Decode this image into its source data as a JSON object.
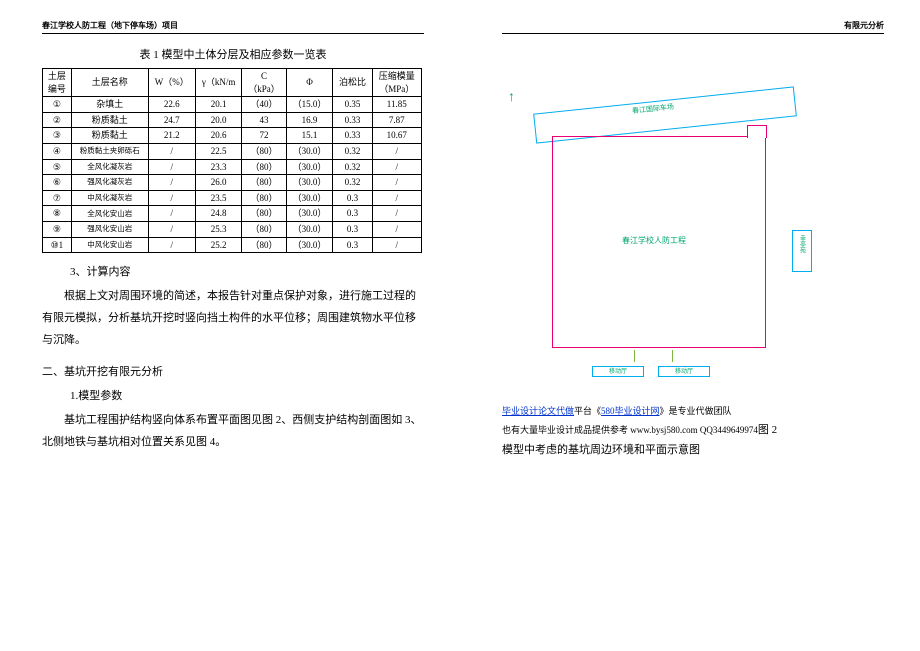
{
  "header": {
    "left": "春江学校人防工程（地下停车场）项目",
    "right": "有限元分析"
  },
  "table": {
    "title": "表 1  模型中土体分层及相应参数一览表",
    "cols": {
      "c1a": "土层",
      "c1b": "编号",
      "c2": "土层名称",
      "c3": "W（%）",
      "c4": "γ（kN/m",
      "c5a": "C",
      "c5b": "（kPa）",
      "c6": "Φ",
      "c7": "泊松比",
      "c8a": "压缩模量",
      "c8b": "（MPa）"
    },
    "rows": [
      {
        "id": "①",
        "name": "杂填土",
        "w": "22.6",
        "g": "20.1",
        "c": "（40）",
        "phi": "（15.0）",
        "po": "0.35",
        "e": "11.85"
      },
      {
        "id": "②",
        "name": "粉质黏土",
        "w": "24.7",
        "g": "20.0",
        "c": "43",
        "phi": "16.9",
        "po": "0.33",
        "e": "7.87"
      },
      {
        "id": "③",
        "name": "粉质黏土",
        "w": "21.2",
        "g": "20.6",
        "c": "72",
        "phi": "15.1",
        "po": "0.33",
        "e": "10.67"
      },
      {
        "id": "④",
        "name": "粉质黏土夹卵砾石",
        "w": "/",
        "g": "22.5",
        "c": "（80）",
        "phi": "（30.0）",
        "po": "0.32",
        "e": "/"
      },
      {
        "id": "⑤",
        "name": "全风化凝灰岩",
        "w": "/",
        "g": "23.3",
        "c": "（80）",
        "phi": "（30.0）",
        "po": "0.32",
        "e": "/"
      },
      {
        "id": "⑥",
        "name": "强风化凝灰岩",
        "w": "/",
        "g": "26.0",
        "c": "（80）",
        "phi": "（30.0）",
        "po": "0.32",
        "e": "/"
      },
      {
        "id": "⑦",
        "name": "中风化凝灰岩",
        "w": "/",
        "g": "23.5",
        "c": "（80）",
        "phi": "（30.0）",
        "po": "0.3",
        "e": "/"
      },
      {
        "id": "⑧",
        "name": "全风化安山岩",
        "w": "/",
        "g": "24.8",
        "c": "（80）",
        "phi": "（30.0）",
        "po": "0.3",
        "e": "/"
      },
      {
        "id": "⑨",
        "name": "强风化安山岩",
        "w": "/",
        "g": "25.3",
        "c": "（80）",
        "phi": "（30.0）",
        "po": "0.3",
        "e": "/"
      },
      {
        "id": "⑩1",
        "name": "中风化安山岩",
        "w": "/",
        "g": "25.2",
        "c": "（80）",
        "phi": "（30.0）",
        "po": "0.3",
        "e": "/"
      }
    ]
  },
  "body": {
    "s3": "3、计算内容",
    "p1": "根据上文对周围环境的简述，本报告针对重点保护对象，进行施工过程的有限元模拟，分析基坑开挖时竖向挡土构件的水平位移；周围建筑物水平位移与沉降。",
    "h2": "二、基坑开挖有限元分析",
    "h3": "1.模型参数",
    "p2": "基坑工程围护结构竖向体系布置平面图见图 2、西侧支护结构剖面图如 3、北侧地铁与基坑相对位置关系见图 4。"
  },
  "diagram": {
    "topbar": "春江国际车场",
    "main": "春江学校人防工程",
    "side": "幸亭苑",
    "b1": "移动厅",
    "b2": "移动厅"
  },
  "footer": {
    "l1a": "毕业设计论文代做",
    "l1b": "平台《",
    "l1c": "580毕业设计网",
    "l1d": "》是专业代做团队",
    "l2": "也有大量毕业设计成品提供参考 www.bysj580.com  QQ3449649974",
    "fig2a": "图 2",
    "fig2b": "模型中考虑的基坑周边环境和平面示意图"
  }
}
